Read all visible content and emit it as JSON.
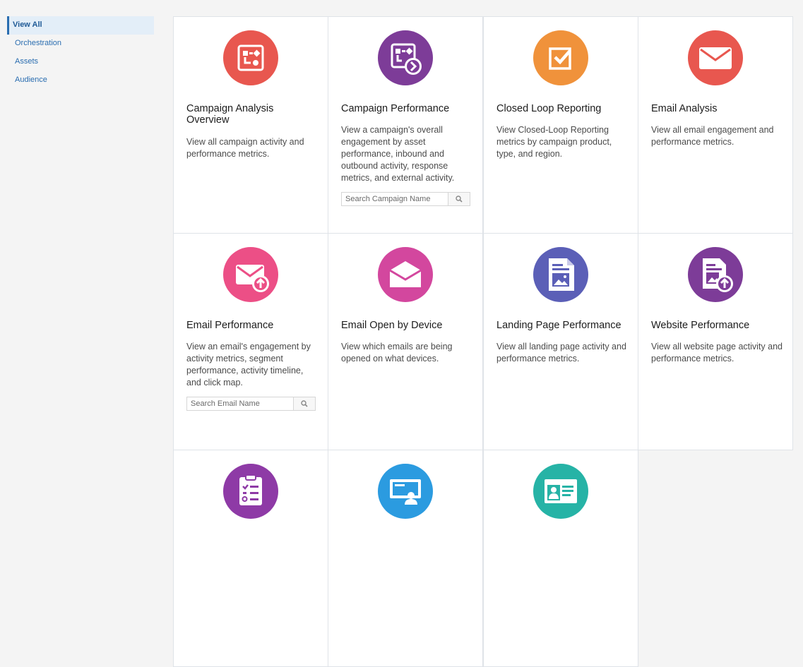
{
  "sidebar": {
    "items": [
      {
        "label": "View All",
        "active": true
      },
      {
        "label": "Orchestration"
      },
      {
        "label": "Assets"
      },
      {
        "label": "Audience"
      }
    ]
  },
  "cards": [
    {
      "title": "Campaign Analysis Overview",
      "description": "View all campaign activity and performance metrics.",
      "icon": "campaign-flow-icon",
      "color": "#e8574f"
    },
    {
      "title": "Campaign Performance",
      "description": "View a campaign's overall engagement by asset performance, inbound and outbound activity, response metrics, and external activity.",
      "icon": "campaign-flow-arrow-icon",
      "color": "#7d3c98",
      "search_placeholder": "Search Campaign Name"
    },
    {
      "title": "Closed Loop Reporting",
      "description": "View Closed-Loop Reporting metrics by campaign product, type, and region.",
      "icon": "checkbox-icon",
      "color": "#f0923b"
    },
    {
      "title": "Email Analysis",
      "description": "View all email engagement and performance metrics.",
      "icon": "envelope-icon",
      "color": "#e8574f"
    },
    {
      "title": "Email Performance",
      "description": "View an email's engagement by activity metrics, segment performance, activity timeline, and click map.",
      "icon": "envelope-upload-icon",
      "color": "#ec4f86",
      "search_placeholder": "Search Email Name"
    },
    {
      "title": "Email Open by Device",
      "description": "View which emails are being opened on what devices.",
      "icon": "envelope-open-icon",
      "color": "#d3479e"
    },
    {
      "title": "Landing Page Performance",
      "description": "View all landing page activity and performance metrics.",
      "icon": "document-image-icon",
      "color": "#5b5fb7"
    },
    {
      "title": "Website Performance",
      "description": "View all website page activity and performance metrics.",
      "icon": "document-upload-icon",
      "color": "#7d3c98"
    },
    {
      "title": "",
      "description": "",
      "icon": "clipboard-list-icon",
      "color": "#8e3aa6"
    },
    {
      "title": "",
      "description": "",
      "icon": "presenter-icon",
      "color": "#2b9be0"
    },
    {
      "title": "",
      "description": "",
      "icon": "contact-card-icon",
      "color": "#26b3a6"
    }
  ]
}
